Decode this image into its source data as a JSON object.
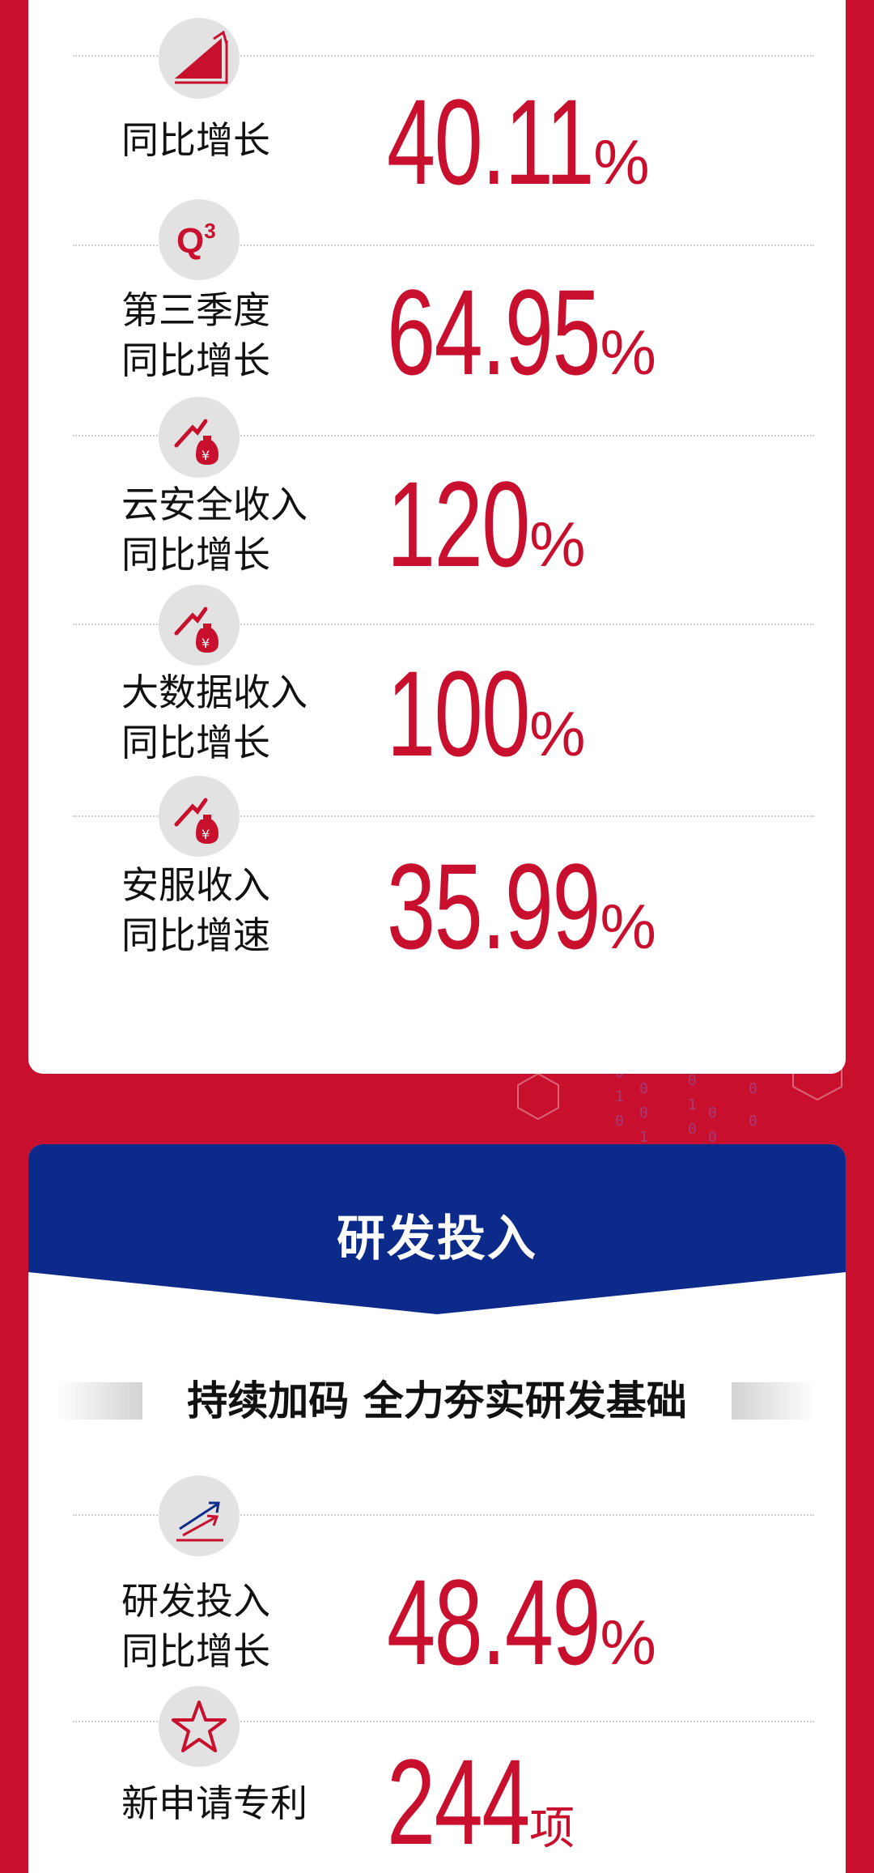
{
  "metrics_top": [
    {
      "icon": "growth-chart-icon",
      "label_lines": [
        "同比增长"
      ],
      "value": "40.11",
      "unit": "%"
    },
    {
      "icon": "q3-icon",
      "icon_text": "Q3",
      "label_lines": [
        "第三季度",
        "同比增长"
      ],
      "value": "64.95",
      "unit": "%"
    },
    {
      "icon": "money-bag-growth-icon",
      "label_lines": [
        "云安全收入",
        "同比增长"
      ],
      "value": "120",
      "unit": "%"
    },
    {
      "icon": "money-bag-growth-icon",
      "label_lines": [
        "大数据收入",
        "同比增长"
      ],
      "value": "100",
      "unit": "%"
    },
    {
      "icon": "money-bag-growth-icon",
      "label_lines": [
        "安服收入",
        "同比增速"
      ],
      "value": "35.99",
      "unit": "%"
    }
  ],
  "rd_section": {
    "title": "研发投入",
    "subtitle": "持续加码 全力夯实研发基础",
    "header_color": "#0b2a8a",
    "metrics": [
      {
        "icon": "trend-arrows-icon",
        "label_lines": [
          "研发投入",
          "同比增长"
        ],
        "value": "48.49",
        "unit": "%"
      },
      {
        "icon": "star-icon",
        "label_lines": [
          "新申请专利"
        ],
        "value": "244",
        "unit": "项"
      }
    ]
  },
  "colors": {
    "brand_red": "#c8102e",
    "navy": "#0b2a8a",
    "icon_bg": "#e2e2e2"
  }
}
